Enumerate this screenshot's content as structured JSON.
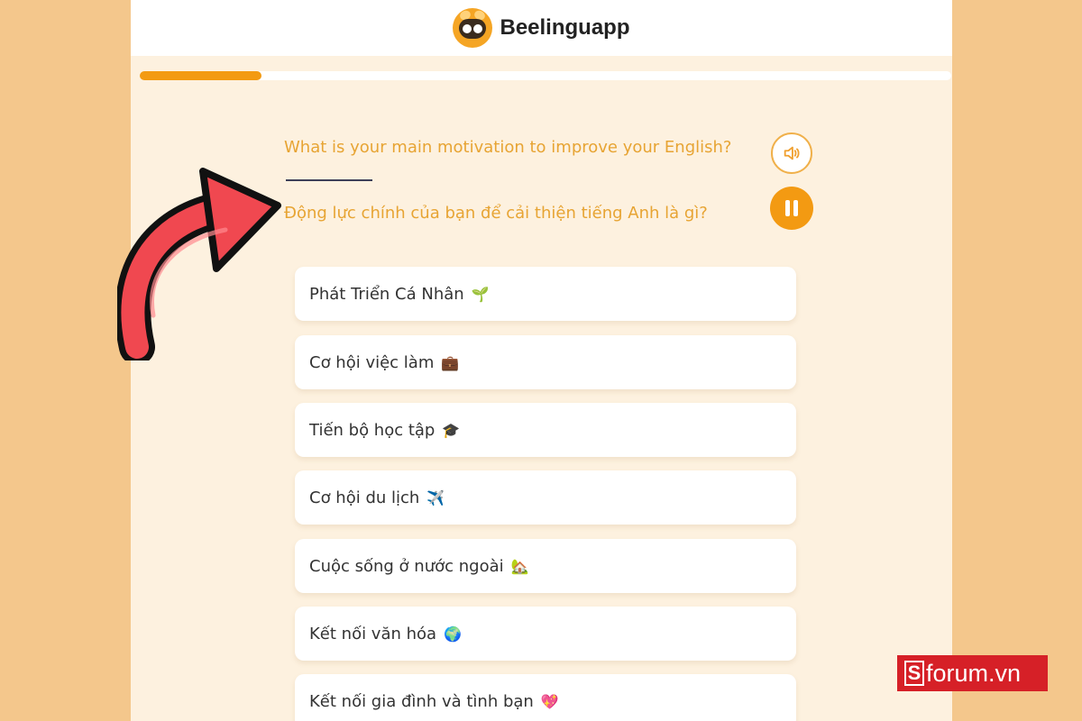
{
  "header": {
    "brand": "Beelinguapp"
  },
  "progress": {
    "fraction": 0.15
  },
  "question": {
    "english": "What is your main motivation to improve your English?",
    "vietnamese": "Động lực chính của bạn để cải thiện tiếng Anh là gì?"
  },
  "icons": {
    "sound": "speaker-icon",
    "pause": "pause-icon",
    "logo": "bee-logo-icon",
    "arrow": "red-curved-arrow-icon"
  },
  "colors": {
    "accent": "#f39a12",
    "question_text": "#e7a433",
    "page_bg": "#fdf1df",
    "outer_bg": "#f4c78c",
    "watermark": "#d62027"
  },
  "options": [
    {
      "label": "Phát Triển Cá Nhân",
      "emoji": "🌱"
    },
    {
      "label": "Cơ hội việc làm",
      "emoji": "💼"
    },
    {
      "label": "Tiến bộ học tập",
      "emoji": "🎓"
    },
    {
      "label": "Cơ hội du lịch",
      "emoji": "✈️"
    },
    {
      "label": "Cuộc sống ở nước ngoài",
      "emoji": "🏡"
    },
    {
      "label": "Kết nối văn hóa",
      "emoji": "🌍"
    },
    {
      "label": "Kết nối gia đình và tình bạn",
      "emoji": "💖"
    }
  ],
  "watermark": {
    "box_letter": "S",
    "text": "forum.vn"
  }
}
